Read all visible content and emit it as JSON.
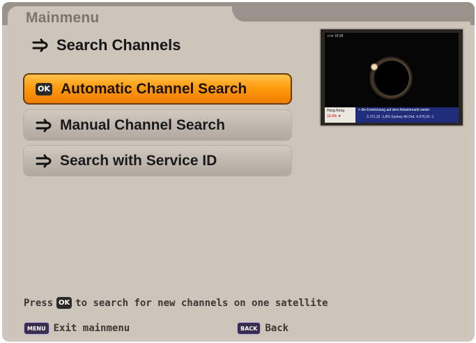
{
  "menu": {
    "title": "Mainmenu"
  },
  "section": {
    "title": "Search Channels",
    "icon": "arrow-icon"
  },
  "items": [
    {
      "label": "Automatic Channel Search",
      "icon": "ok-icon",
      "badge": "OK",
      "selected": true
    },
    {
      "label": "Manual Channel Search",
      "icon": "arrow-icon",
      "selected": false
    },
    {
      "label": "Search with Service ID",
      "icon": "arrow-icon",
      "selected": false
    }
  ],
  "preview": {
    "channel": "n-tv 18:38",
    "ticker_city": "Hong Kong",
    "ticker_city_value": "15.9% ▼",
    "ticker_news": "> die Entwicklung auf dem Arbeitsmarkt weiter",
    "ticker_stats": "3.721,33 -1,8%      Sydney All Ord. 4.976,00 -1"
  },
  "hint": {
    "before": "Press",
    "badge": "OK",
    "after": "to search for new channels on one satellite"
  },
  "footer": {
    "menu_key": "MENU",
    "menu_label": "Exit mainmenu",
    "back_key": "BACK",
    "back_label": "Back"
  },
  "colors": {
    "selected": "#ff9c10",
    "panel": "#cdc4ba",
    "text": "#1a1a1a"
  }
}
